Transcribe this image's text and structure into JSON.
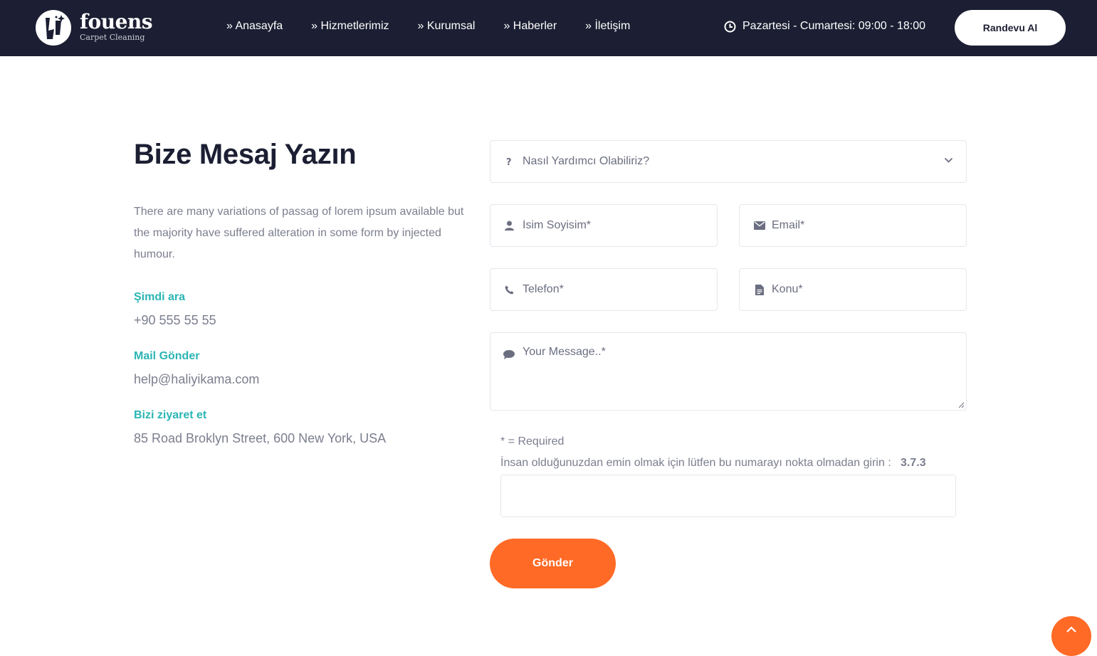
{
  "brand": {
    "name": "fouens",
    "tagline": "Carpet Cleaning"
  },
  "nav": {
    "items": [
      "» Anasayfa",
      "» Hizmetlerimiz",
      "» Kurumsal",
      "» Haberler",
      "» İletişim"
    ],
    "hours": "Pazartesi - Cumartesi: 09:00 - 18:00",
    "cta": "Randevu Al"
  },
  "contact": {
    "title": "Bize Mesaj Yazın",
    "intro": "There are many variations of passag of lorem ipsum available but the majority have suffered alteration in some form by injected humour.",
    "call_label": "Şimdi ara",
    "phone": "+90 555 55 55",
    "mail_label": "Mail Gönder",
    "email": "help@haliyikama.com",
    "visit_label": "Bizi ziyaret et",
    "address": "85 Road Broklyn Street, 600 New York, USA"
  },
  "form": {
    "topic_placeholder": "Nasıl Yardımcı Olabiliriz?",
    "name_placeholder": "İsim Soyisim*",
    "email_placeholder": "Email*",
    "phone_placeholder": "Telefon*",
    "subject_placeholder": "Konu*",
    "message_placeholder": "Your Message..*",
    "required_note": "* = Required",
    "captcha_prompt": "İnsan olduğunuzdan emin olmak için lütfen bu numarayı nokta olmadan girin :",
    "captcha_code": "3.7.3",
    "submit_label": "Gönder"
  },
  "colors": {
    "navy": "#1c1f33",
    "accent_orange": "#ff6a26",
    "accent_teal": "#2bb5b5",
    "muted_text": "#7b7e8e"
  },
  "icons": [
    "clock-icon",
    "question-icon",
    "user-icon",
    "envelope-icon",
    "phone-icon",
    "file-icon",
    "comment-icon",
    "chevron-down-icon",
    "chevron-up-icon"
  ]
}
